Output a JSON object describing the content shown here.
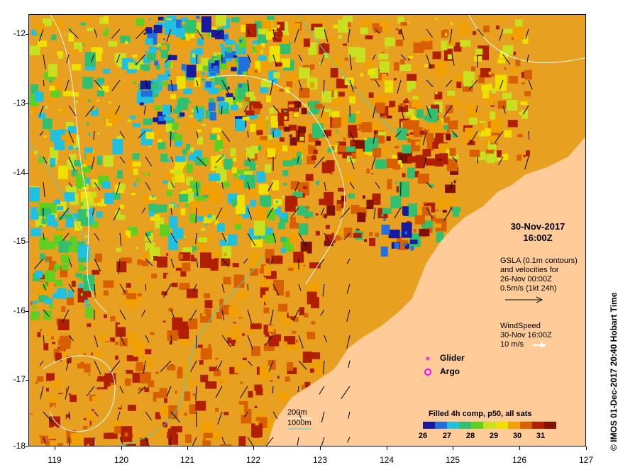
{
  "map": {
    "date": "30-Nov-2017",
    "time": "16:00Z",
    "gsla_lines": [
      "GSLA (0.1m contours)",
      "and velocities for",
      "26-Nov 00:00Z",
      "0.5m/s (1kt 24h)"
    ],
    "wind_lines": [
      "WindSpeed",
      "30-Nov 16:00Z",
      "10 m/s"
    ],
    "legend_glider": "Glider",
    "legend_argo": "Argo",
    "depth_200": "200m",
    "depth_1000": "1000m",
    "colorbar_title": "Filled 4h comp, p50, all sats",
    "colorbar_ticks": [
      "26",
      "27",
      "28",
      "29",
      "30",
      "31"
    ],
    "colorbar_colors": [
      "#1a1aa0",
      "#2070e0",
      "#20c0e0",
      "#30c070",
      "#60d020",
      "#c8e020",
      "#f0e000",
      "#f0a000",
      "#d86000",
      "#b02000",
      "#801000"
    ],
    "side_label": "© IMOS 01-Dec-2017 20:40 Hobart Time",
    "lat_ticks": [
      "-12",
      "-13",
      "-14",
      "-15",
      "-16",
      "-17",
      "-18"
    ],
    "lon_ticks": [
      "119",
      "120",
      "121",
      "122",
      "123",
      "124",
      "125",
      "126",
      "127"
    ],
    "colors": {
      "land": "#ffcc99",
      "glider": "#ff33cc",
      "argo": "#ff00ff",
      "isobath_1000": "#40d0d0"
    }
  }
}
